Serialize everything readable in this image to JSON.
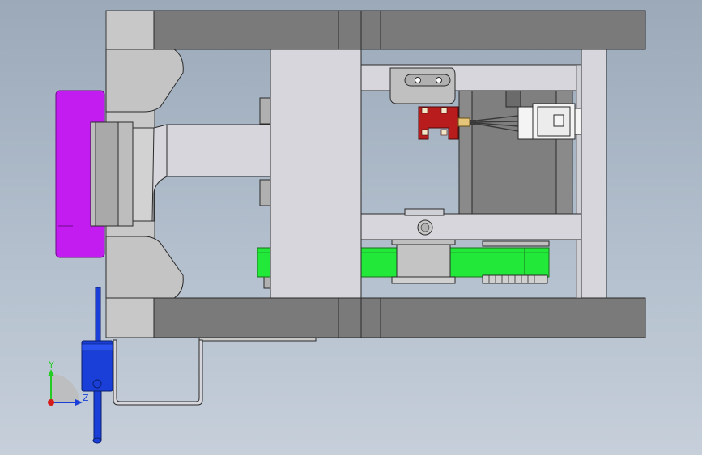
{
  "view": {
    "type": "CAD model viewport",
    "background_top": "#9ba9b9",
    "background_bottom": "#c6cfda"
  },
  "colors": {
    "frame_dark": "#7a7a7a",
    "frame_light": "#d6d6dc",
    "bracket_gray": "#c4c4c4",
    "purple_block": "#c21cf0",
    "belt_green": "#22e83a",
    "sensor_red": "#b81c1c",
    "connector_white": "#f4f4f4",
    "cylinder_blue": "#1a3fd8",
    "motor_gray": "#8a8a8a"
  },
  "triad": {
    "y_label": "Y",
    "z_label": "Z",
    "y_color": "#22cc22",
    "x_color": "#1a3fd8",
    "origin_color": "#d61b1b"
  }
}
